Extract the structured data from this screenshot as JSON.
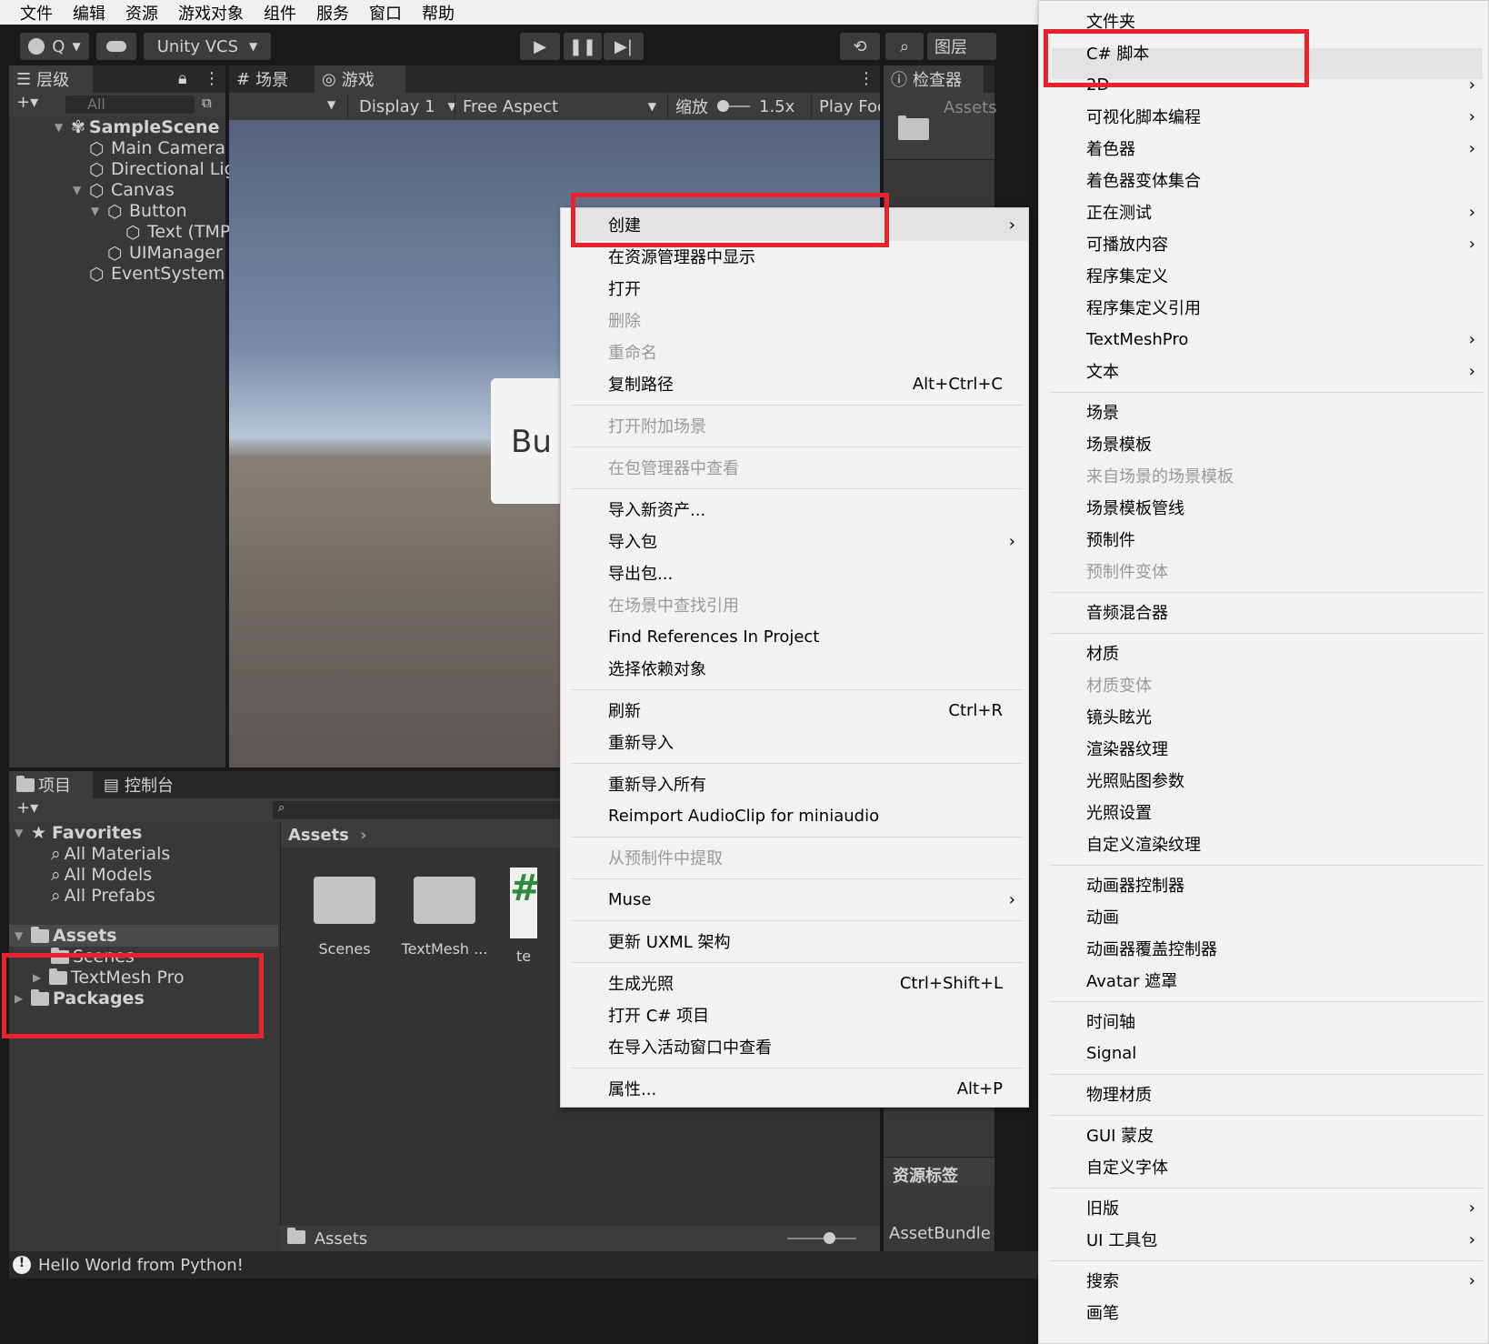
{
  "menubar": [
    "文件",
    "编辑",
    "资源",
    "游戏对象",
    "组件",
    "服务",
    "窗口",
    "帮助"
  ],
  "toolbar": {
    "account_label": "Q",
    "vcs_label": "Unity VCS",
    "layers_label": "图层"
  },
  "hierarchy": {
    "tab": "层级",
    "search_placeholder": "All",
    "scene": "SampleScene",
    "items": [
      "Main Camera",
      "Directional Lig",
      "Canvas",
      "Button",
      "Text (TMP",
      "UIManager",
      "EventSystem"
    ]
  },
  "game_view": {
    "tab_scene": "场景",
    "tab_game": "游戏",
    "display": "Display 1",
    "aspect": "Free Aspect",
    "zoom_label": "缩放",
    "zoom_value": "1.5x",
    "play_focused": "Play Foc",
    "button_text": "Bu"
  },
  "inspector": {
    "tab": "检查器",
    "path": "Assets",
    "asset_labels": "资源标签",
    "asset_bundle": "AssetBundle"
  },
  "project": {
    "tab_project": "项目",
    "tab_console": "控制台",
    "favorites": "Favorites",
    "favorite_items": [
      "All Materials",
      "All Models",
      "All Prefabs"
    ],
    "assets": "Assets",
    "asset_children": [
      "Scenes",
      "TextMesh Pro"
    ],
    "packages": "Packages",
    "breadcrumb": "Assets",
    "grid_items": [
      "Scenes",
      "TextMesh ...",
      "te"
    ],
    "footer_path": "Assets"
  },
  "status_bar": {
    "message": "Hello World from Python!"
  },
  "context_menu": {
    "items": [
      {
        "label": "创建",
        "submenu": true,
        "highlighted": true
      },
      {
        "label": "在资源管理器中显示"
      },
      {
        "label": "打开"
      },
      {
        "label": "删除",
        "disabled": true
      },
      {
        "label": "重命名",
        "disabled": true
      },
      {
        "label": "复制路径",
        "shortcut": "Alt+Ctrl+C"
      },
      {
        "label": "打开附加场景",
        "disabled": true
      },
      {
        "label": "在包管理器中查看",
        "disabled": true
      },
      {
        "label": "导入新资产..."
      },
      {
        "label": "导入包",
        "submenu": true
      },
      {
        "label": "导出包..."
      },
      {
        "label": "在场景中查找引用",
        "disabled": true
      },
      {
        "label": "Find References In Project"
      },
      {
        "label": "选择依赖对象"
      },
      {
        "label": "刷新",
        "shortcut": "Ctrl+R"
      },
      {
        "label": "重新导入"
      },
      {
        "label": "重新导入所有"
      },
      {
        "label": "Reimport AudioClip for miniaudio"
      },
      {
        "label": "从预制件中提取",
        "disabled": true
      },
      {
        "label": "Muse",
        "submenu": true
      },
      {
        "label": "更新 UXML 架构"
      },
      {
        "label": "生成光照",
        "shortcut": "Ctrl+Shift+L"
      },
      {
        "label": "打开 C# 项目"
      },
      {
        "label": "在导入活动窗口中查看"
      },
      {
        "label": "属性...",
        "shortcut": "Alt+P"
      }
    ]
  },
  "create_submenu": {
    "items": [
      {
        "label": "文件夹"
      },
      {
        "label": "C# 脚本",
        "highlighted": true
      },
      {
        "label": "2D",
        "submenu": true
      },
      {
        "label": "可视化脚本编程",
        "submenu": true
      },
      {
        "label": "着色器",
        "submenu": true
      },
      {
        "label": "着色器变体集合"
      },
      {
        "label": "正在测试",
        "submenu": true
      },
      {
        "label": "可播放内容",
        "submenu": true
      },
      {
        "label": "程序集定义"
      },
      {
        "label": "程序集定义引用"
      },
      {
        "label": "TextMeshPro",
        "submenu": true
      },
      {
        "label": "文本",
        "submenu": true
      },
      {
        "label": "场景"
      },
      {
        "label": "场景模板"
      },
      {
        "label": "来自场景的场景模板",
        "disabled": true
      },
      {
        "label": "场景模板管线"
      },
      {
        "label": "预制件"
      },
      {
        "label": "预制件变体",
        "disabled": true
      },
      {
        "label": "音频混合器"
      },
      {
        "label": "材质"
      },
      {
        "label": "材质变体",
        "disabled": true
      },
      {
        "label": "镜头眩光"
      },
      {
        "label": "渲染器纹理"
      },
      {
        "label": "光照贴图参数"
      },
      {
        "label": "光照设置"
      },
      {
        "label": "自定义渲染纹理"
      },
      {
        "label": "动画器控制器"
      },
      {
        "label": "动画"
      },
      {
        "label": "动画器覆盖控制器"
      },
      {
        "label": "Avatar 遮罩"
      },
      {
        "label": "时间轴"
      },
      {
        "label": "Signal"
      },
      {
        "label": "物理材质"
      },
      {
        "label": "GUI 蒙皮"
      },
      {
        "label": "自定义字体"
      },
      {
        "label": "旧版",
        "submenu": true
      },
      {
        "label": "UI 工具包",
        "submenu": true
      },
      {
        "label": "搜索",
        "submenu": true
      },
      {
        "label": "画笔"
      }
    ]
  },
  "colors": {
    "highlight_box": "#e8232d",
    "menu_bg": "#f2f2f2",
    "editor_dark": "#383838"
  }
}
